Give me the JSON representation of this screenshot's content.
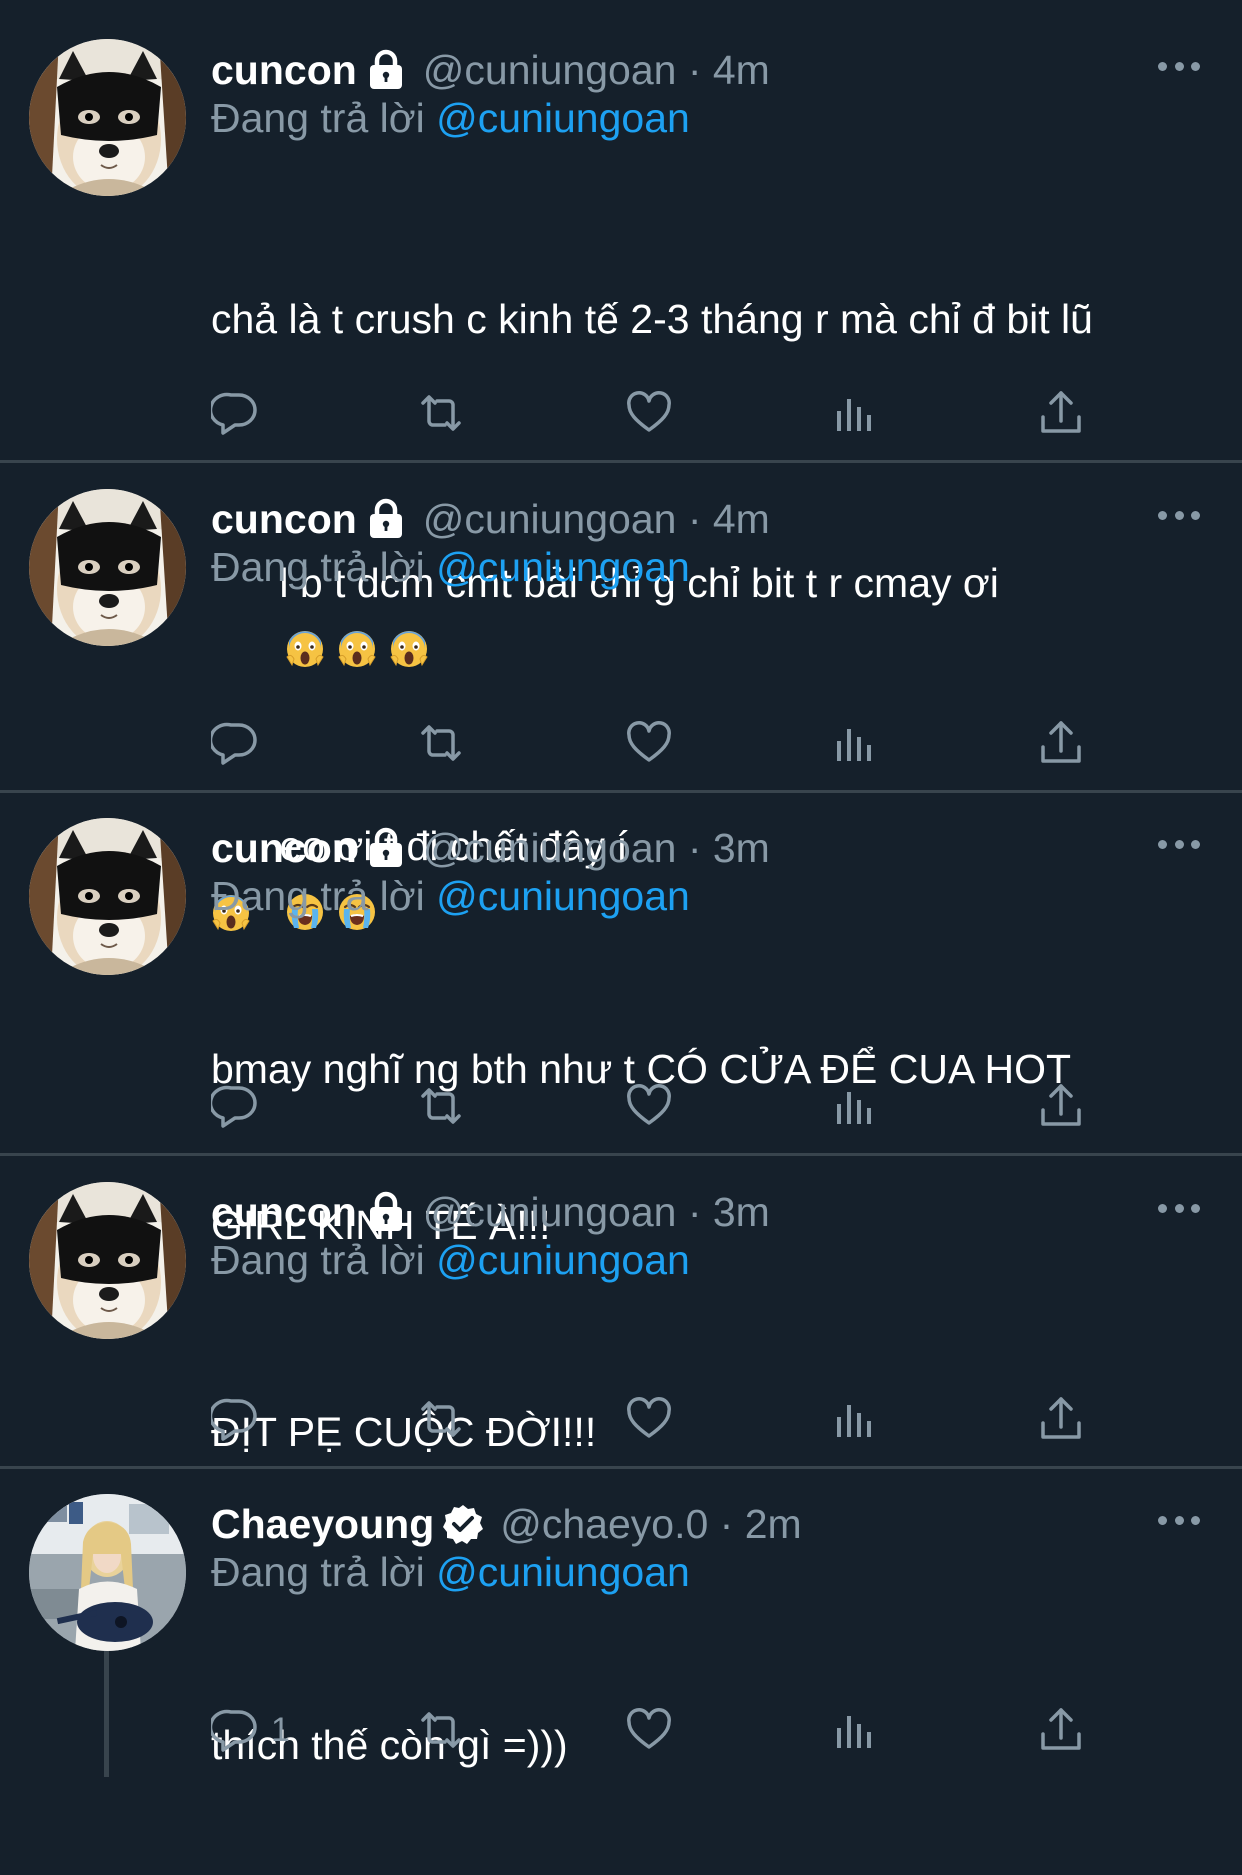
{
  "colors": {
    "background": "#15202b",
    "text": "#ffffff",
    "secondary": "#8899a6",
    "accent": "#1da1f2",
    "divider": "#38444d"
  },
  "tweets": [
    {
      "name": "cuncon",
      "badge": "lock-icon",
      "handle_time": "@cuniungoan · 4m",
      "reply_prefix": "Đang trả lời",
      "reply_mention": "@cuniungoan",
      "text_lines": [
        "chả là t crush c kinh tế 2-3 tháng r mà chỉ đ bit lũ",
        "l b t dcm cmt bải chỉ g chỉ bit t r cmay ơi"
      ],
      "emojis": [
        "scream-emoji",
        "scream-emoji",
        "scream-emoji",
        "scream-emoji"
      ],
      "reply_count": ""
    },
    {
      "name": "cuncon",
      "badge": "lock-icon",
      "handle_time": "@cuniungoan · 4m",
      "reply_prefix": "Đang trả lời",
      "reply_mention": "@cuniungoan",
      "text_lines": [
        "eo ơi t đi chết đây í"
      ],
      "emojis": [
        "loudly-crying-emoji",
        "loudly-crying-emoji"
      ],
      "reply_count": ""
    },
    {
      "name": "cuncon",
      "badge": "lock-icon",
      "handle_time": "@cuniungoan · 3m",
      "reply_prefix": "Đang trả lời",
      "reply_mention": "@cuniungoan",
      "text_lines": [
        "bmay nghĩ ng bth như t CÓ CỬA ĐỂ CUA HOT",
        "GIRL KINH TẾ À!!!"
      ],
      "emojis": [],
      "reply_count": ""
    },
    {
      "name": "cuncon",
      "badge": "lock-icon",
      "handle_time": "@cuniungoan · 3m",
      "reply_prefix": "Đang trả lời",
      "reply_mention": "@cuniungoan",
      "text_lines": [
        "ĐỊT PẸ CUỘC ĐỜI!!!"
      ],
      "emojis": [],
      "reply_count": ""
    },
    {
      "name": "Chaeyoung",
      "badge": "verified-icon",
      "handle_time": "@chaeyo.0 · 2m",
      "reply_prefix": "Đang trả lời",
      "reply_mention": "@cuniungoan",
      "text_lines": [
        "thích thế còn gì =)))"
      ],
      "emojis": [],
      "reply_count": "1"
    }
  ],
  "action_icons": [
    "reply-icon",
    "retweet-icon",
    "like-icon",
    "analytics-icon",
    "share-icon"
  ]
}
